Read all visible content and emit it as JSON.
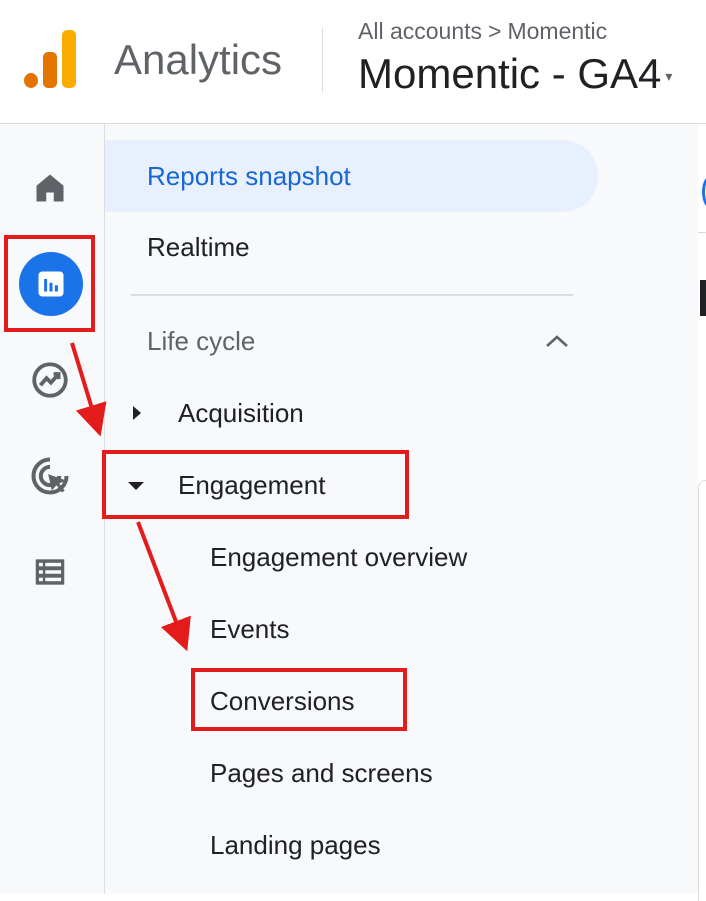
{
  "header": {
    "app_name": "Analytics",
    "breadcrumb": [
      "All accounts",
      "Momentic"
    ],
    "breadcrumb_separator": ">",
    "property_name": "Momentic - GA4"
  },
  "rail": {
    "items": [
      {
        "icon": "home-icon",
        "active": false
      },
      {
        "icon": "reports-icon",
        "active": true
      },
      {
        "icon": "explore-icon",
        "active": false
      },
      {
        "icon": "advertising-icon",
        "active": false
      },
      {
        "icon": "configure-list-icon",
        "active": false
      }
    ]
  },
  "nav": {
    "reports_snapshot": "Reports snapshot",
    "realtime": "Realtime",
    "section": "Life cycle",
    "acquisition": "Acquisition",
    "engagement": "Engagement",
    "engagement_children": [
      "Engagement overview",
      "Events",
      "Conversions",
      "Pages and screens",
      "Landing pages"
    ]
  },
  "colors": {
    "accent": "#1a73e8",
    "active_bg": "#e8f0fe",
    "annotation_red": "#e31b1b",
    "logo_orange": "#e37400",
    "logo_yellow": "#f9ab00"
  }
}
